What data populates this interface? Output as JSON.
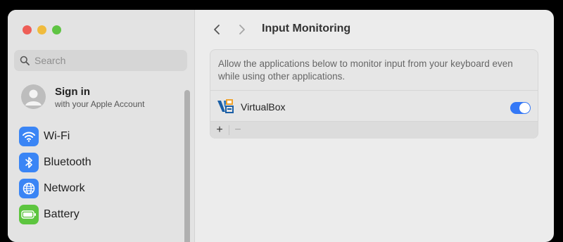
{
  "sidebar": {
    "search_placeholder": "Search",
    "account": {
      "title": "Sign in",
      "subtitle": "with your Apple Account"
    },
    "items": [
      {
        "label": "Wi-Fi",
        "icon": "wifi-icon",
        "color": "#3a85f5"
      },
      {
        "label": "Bluetooth",
        "icon": "bluetooth-icon",
        "color": "#3a85f5"
      },
      {
        "label": "Network",
        "icon": "globe-icon",
        "color": "#3a85f5"
      },
      {
        "label": "Battery",
        "icon": "battery-icon",
        "color": "#5dc53f"
      }
    ]
  },
  "header": {
    "title": "Input Monitoring"
  },
  "panel": {
    "description": "Allow the applications below to monitor input from your keyboard even while using other applications.",
    "apps": [
      {
        "name": "VirtualBox",
        "enabled": true
      }
    ],
    "add_label": "+",
    "remove_label": "−"
  },
  "colors": {
    "accent": "#3478f6"
  }
}
